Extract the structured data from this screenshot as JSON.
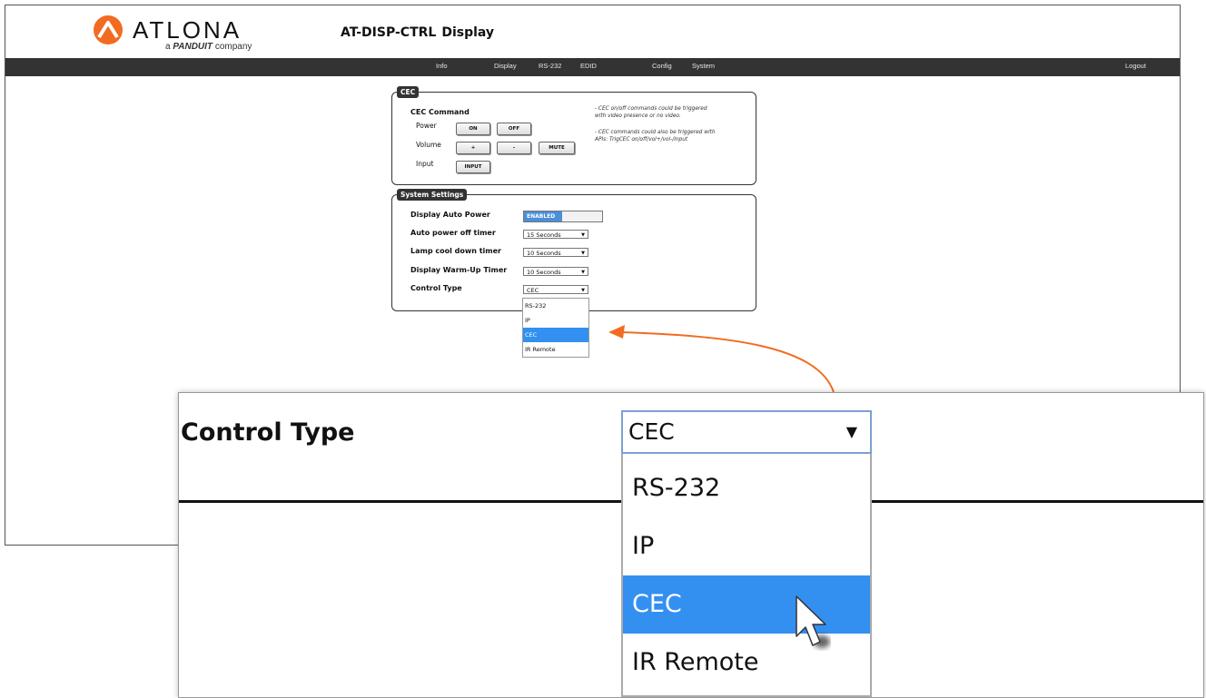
{
  "brand": {
    "logo_text": "ATLONA",
    "tagline_prefix": "a",
    "tagline_brand": "PANDUIT",
    "tagline_suffix": "company",
    "accent": "#f26b21"
  },
  "header": {
    "model": "AT-DISP-CTRL",
    "page": "Display"
  },
  "nav": {
    "items": [
      "Info",
      "Display",
      "RS-232",
      "EDID",
      "Config",
      "System"
    ],
    "logout": "Logout"
  },
  "cec": {
    "tab": "CEC",
    "heading": "CEC Command",
    "power_label": "Power",
    "on": "ON",
    "off": "OFF",
    "volume_label": "Volume",
    "vol_up": "+",
    "vol_down": "-",
    "mute": "MUTE",
    "input_label": "Input",
    "input": "INPUT",
    "note1_line1": "- CEC on/off commands could be triggered",
    "note1_line2": "with video presence or no video.",
    "note2_line1": "- CEC commands could also be triggered with",
    "note2_line2": "APIs: TrigCEC on/off/vol+/vol-/input"
  },
  "system": {
    "tab": "System Settings",
    "auto_power_label": "Display Auto Power",
    "auto_power_state": "ENABLED",
    "auto_off_label": "Auto power off timer",
    "auto_off_value": "15 Seconds",
    "lamp_label": "Lamp cool down timer",
    "lamp_value": "10 Seconds",
    "warmup_label": "Display Warm-Up Timer",
    "warmup_value": "10 Seconds",
    "control_label": "Control Type",
    "control_value": "CEC",
    "control_options": [
      "RS-232",
      "IP",
      "CEC",
      "IR Remote"
    ],
    "highlighted_option": "CEC"
  },
  "colors": {
    "nav_bg": "#333333",
    "highlight": "#3390f0",
    "callout": "#f26b21"
  }
}
